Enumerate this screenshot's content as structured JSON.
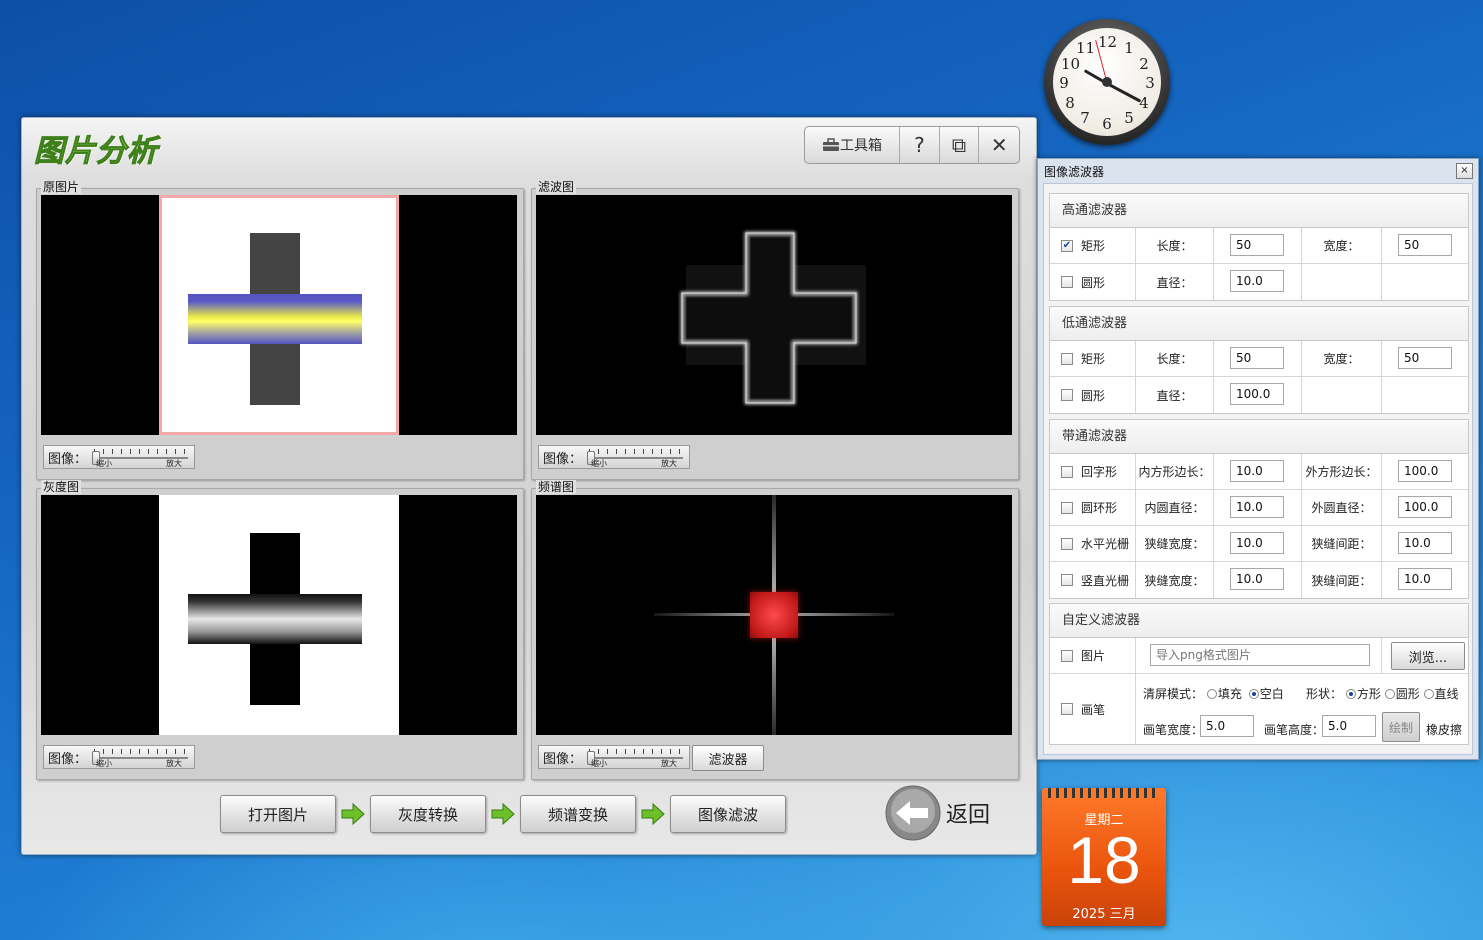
{
  "desktop": {
    "clock": {
      "numbers": [
        "12",
        "1",
        "2",
        "3",
        "4",
        "5",
        "6",
        "7",
        "8",
        "9",
        "10",
        "11"
      ]
    },
    "calendar": {
      "weekday": "星期二",
      "day": "18",
      "year_month": "2025 三月"
    }
  },
  "main_window": {
    "title": "图片分析",
    "toolbar": {
      "toolbox_label": "工具箱",
      "help_label": "?",
      "restore_label": "⧉",
      "close_label": "✕"
    },
    "panels": {
      "original": {
        "label": "原图片"
      },
      "filtered": {
        "label": "滤波图"
      },
      "gray": {
        "label": "灰度图"
      },
      "spectrum": {
        "label": "频谱图"
      }
    },
    "zoom": {
      "label": "图像：",
      "min_label": "缩小",
      "max_label": "放大"
    },
    "spectrum_filter_button": "滤波器",
    "steps": [
      "打开图片",
      "灰度转换",
      "频谱变换",
      "图像滤波"
    ],
    "back_label": "返回"
  },
  "filter_window": {
    "title": "图像滤波器",
    "close_label": "×",
    "highpass": {
      "title": "高通滤波器",
      "rect": {
        "checked": true,
        "label": "矩形",
        "length_label": "长度：",
        "length": "50",
        "width_label": "宽度：",
        "width": "50"
      },
      "circle": {
        "checked": false,
        "label": "圆形",
        "diameter_label": "直径：",
        "diameter": "10.0"
      }
    },
    "lowpass": {
      "title": "低通滤波器",
      "rect": {
        "checked": false,
        "label": "矩形",
        "length_label": "长度：",
        "length": "50",
        "width_label": "宽度：",
        "width": "50"
      },
      "circle": {
        "checked": false,
        "label": "圆形",
        "diameter_label": "直径：",
        "diameter": "100.0"
      }
    },
    "bandpass": {
      "title": "带通滤波器",
      "rows": [
        {
          "checked": false,
          "label": "回字形",
          "a_label": "内方形边长：",
          "a": "10.0",
          "b_label": "外方形边长：",
          "b": "100.0"
        },
        {
          "checked": false,
          "label": "圆环形",
          "a_label": "内圆直径：",
          "a": "10.0",
          "b_label": "外圆直径：",
          "b": "100.0"
        },
        {
          "checked": false,
          "label": "水平光栅",
          "a_label": "狭缝宽度：",
          "a": "10.0",
          "b_label": "狭缝间距：",
          "b": "10.0"
        },
        {
          "checked": false,
          "label": "竖直光栅",
          "a_label": "狭缝宽度：",
          "a": "10.0",
          "b_label": "狭缝间距：",
          "b": "10.0"
        }
      ]
    },
    "custom": {
      "title": "自定义滤波器",
      "image": {
        "checked": false,
        "label": "图片",
        "placeholder": "导入png格式图片",
        "browse_label": "浏览..."
      },
      "brush": {
        "checked": false,
        "label": "画笔",
        "clear_label": "清屏模式：",
        "clear_opt1": "填充",
        "clear_opt2": "空白",
        "clear_selected": 2,
        "shape_label": "形状：",
        "shape_opt1": "方形",
        "shape_opt2": "圆形",
        "shape_opt3": "直线",
        "shape_selected": 1,
        "width_label": "画笔宽度：",
        "width": "5.0",
        "height_label": "画笔高度：",
        "height": "5.0",
        "draw_label": "绘制",
        "eraser_label": "橡皮擦"
      }
    }
  }
}
